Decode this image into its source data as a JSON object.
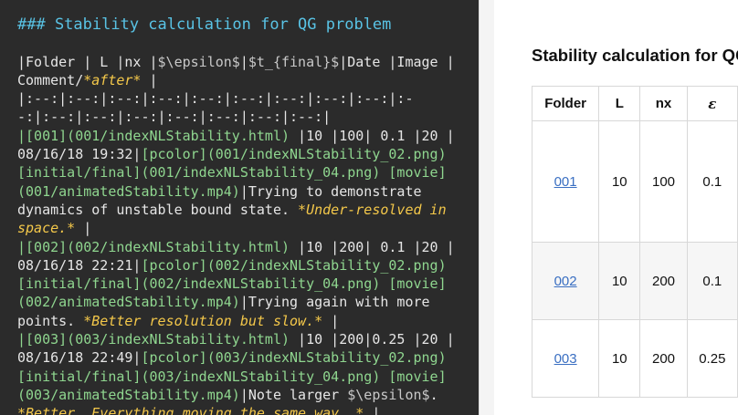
{
  "editor": {
    "heading": "### Stability calculation for QG problem",
    "header_1": "|Folder | L |nx |",
    "header_2": "$\\epsilon$",
    "header_3": "|",
    "header_4": "$t_{final}$",
    "header_5": "|Date |Image |",
    "comment_prefix": "Comment/",
    "comment_em": "*after*",
    "comment_suffix": " |",
    "sep_1": "|:--:|:--:|:--:|:--:|:--:|:--:|:--:|:--:|:--:|:-",
    "sep_2": "-:|:--:|:--:|:--:|:--:|:--:|:--:|:--:|",
    "r1": {
      "link1": "|[001](001/indexNLStability.html)",
      "vals": " |10 |100| 0.1 |20 |",
      "date": "08/16/18 19:32|",
      "link2": "[pcolor](001/indexNLStability_02.png)",
      "link3": "[initial/final](001/indexNLStability_04.png) [movie]",
      "link4": "(001/animatedStability.mp4)",
      "text1": "|Trying to demonstrate",
      "text2": "dynamics of unstable bound state. ",
      "em1": "*Under-resolved in",
      "em2": "space.*",
      "end": " |"
    },
    "r2": {
      "link1": "|[002](002/indexNLStability.html)",
      "vals": " |10 |200| 0.1 |20 |",
      "date": "08/16/18 22:21|",
      "link2": "[pcolor](002/indexNLStability_02.png)",
      "link3": "[initial/final](002/indexNLStability_04.png) [movie]",
      "link4": "(002/animatedStability.mp4)",
      "text1": "|Trying again with more",
      "text2": "points. ",
      "em1": "*Better resolution but slow.*",
      "end": " |"
    },
    "r3": {
      "link1": "|[003](003/indexNLStability.html)",
      "vals": " |10 |200|0.25 |20 |",
      "date": "08/16/18 22:49|",
      "link2": "[pcolor](003/indexNLStability_02.png)",
      "link3": "[initial/final](003/indexNLStability_04.png) [movie]",
      "link4": "(003/animatedStability.mp4)",
      "text1": "|Note larger ",
      "eps": "$\\epsilon$",
      "text2": ".",
      "em1": "*Better. Everything moving the same way. *",
      "end": " |"
    }
  },
  "preview": {
    "title": "Stability calculation for QG problem",
    "columns": [
      "Folder",
      "L",
      "nx",
      "ε"
    ],
    "rows": [
      {
        "folder": "001",
        "L": "10",
        "nx": "100",
        "eps": "0.1"
      },
      {
        "folder": "002",
        "L": "10",
        "nx": "200",
        "eps": "0.1"
      },
      {
        "folder": "003",
        "L": "10",
        "nx": "200",
        "eps": "0.25"
      }
    ]
  }
}
